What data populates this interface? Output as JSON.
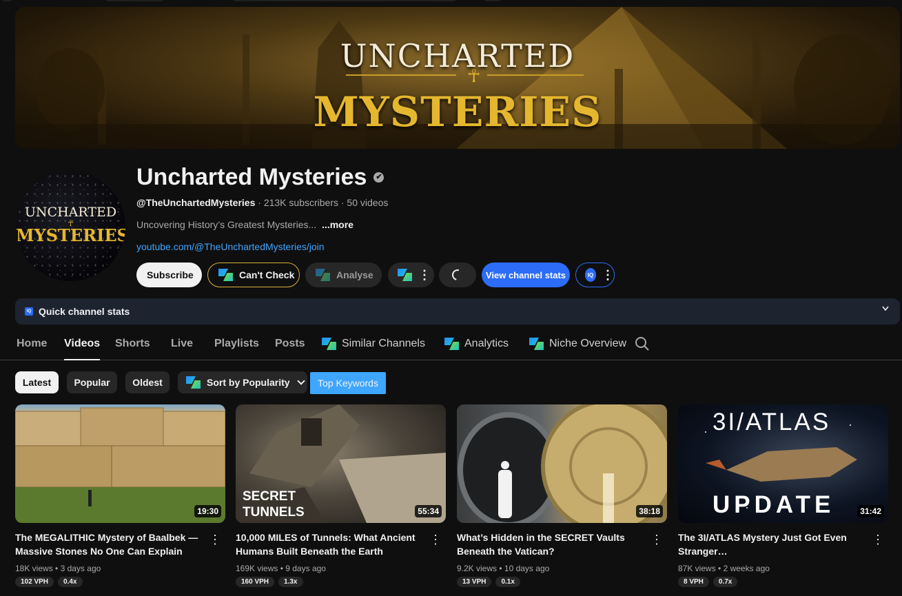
{
  "banner": {
    "title_line1": "UNCHARTED",
    "title_line2": "MYSTERIES",
    "ankh": "☥"
  },
  "avatar": {
    "line1": "UNCHARTED",
    "line2": "MYSTERIES",
    "ankh": "☥"
  },
  "channel": {
    "name": "Uncharted Mysteries",
    "verified_glyph": "✔",
    "handle": "@TheUnchartedMysteries",
    "stats": " · 213K subscribers · 50 videos",
    "description": "Uncovering History’s Greatest Mysteries...",
    "more_label": "...more",
    "join_link": "youtube.com/@TheUnchartedMysteries/join"
  },
  "actions": {
    "subscribe": "Subscribe",
    "cant_check": "Can't Check",
    "analyse": "Analyse",
    "view_stats": "View channel stats",
    "iq_label": "IQ",
    "kebab": "⋮"
  },
  "quick_stats": {
    "label": "Quick channel stats",
    "icon_label": "IQ"
  },
  "tabs": [
    {
      "label": "Home"
    },
    {
      "label": "Videos"
    },
    {
      "label": "Shorts"
    },
    {
      "label": "Live"
    },
    {
      "label": "Playlists"
    },
    {
      "label": "Posts"
    },
    {
      "label": "Similar Channels"
    },
    {
      "label": "Analytics"
    },
    {
      "label": "Niche Overview"
    }
  ],
  "filters": {
    "latest": "Latest",
    "popular": "Popular",
    "oldest": "Oldest",
    "sort": "Sort by Popularity",
    "top_keywords": "Top Keywords"
  },
  "videos": [
    {
      "title": "The MEGALITHIC Mystery of Baalbek — Massive Stones No One Can Explain",
      "views": "18K views",
      "age": "3 days ago",
      "duration": "19:30",
      "vph": "102 VPH",
      "ratio": "0.4x",
      "thumb_text": ""
    },
    {
      "title": "10,000 MILES of Tunnels: What Ancient Humans Built Beneath the Earth",
      "views": "169K views",
      "age": "9 days ago",
      "duration": "55:34",
      "vph": "160 VPH",
      "ratio": "1.3x",
      "thumb_text_1": "SECRET",
      "thumb_text_2": "TUNNELS"
    },
    {
      "title": "What’s Hidden in the SECRET Vaults Beneath the Vatican?",
      "views": "9.2K views",
      "age": "10 days ago",
      "duration": "38:18",
      "vph": "13 VPH",
      "ratio": "0.1x"
    },
    {
      "title": "The 3I/ATLAS Mystery Just Got Even Stranger…",
      "views": "87K views",
      "age": "2 weeks ago",
      "duration": "31:42",
      "vph": "8 VPH",
      "ratio": "0.7x",
      "thumb_text_1": "3I/ATLAS",
      "thumb_text_2": "UPDATE"
    }
  ],
  "meta_sep": " • "
}
